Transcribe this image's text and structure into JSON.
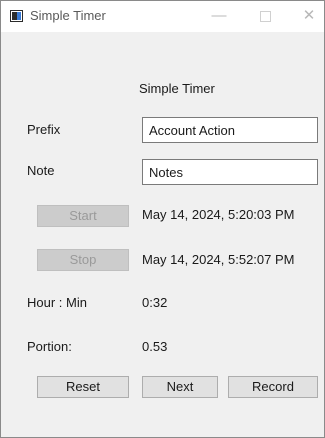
{
  "window": {
    "title": "Simple Timer",
    "controls": {
      "minimize": "—",
      "close": "✕"
    }
  },
  "heading": "Simple Timer",
  "prefix": {
    "label": "Prefix",
    "value": "Account Action"
  },
  "note": {
    "label": "Note",
    "value": "Notes"
  },
  "start": {
    "label": "Start",
    "time": "May 14, 2024, 5:20:03 PM",
    "enabled": false
  },
  "stop": {
    "label": "Stop",
    "time": "May 14, 2024, 5:52:07 PM",
    "enabled": false
  },
  "hour_min": {
    "label": "Hour : Min",
    "value": "0:32"
  },
  "portion": {
    "label": "Portion:",
    "value": "0.53"
  },
  "buttons": {
    "reset": "Reset",
    "next": "Next",
    "record": "Record"
  }
}
